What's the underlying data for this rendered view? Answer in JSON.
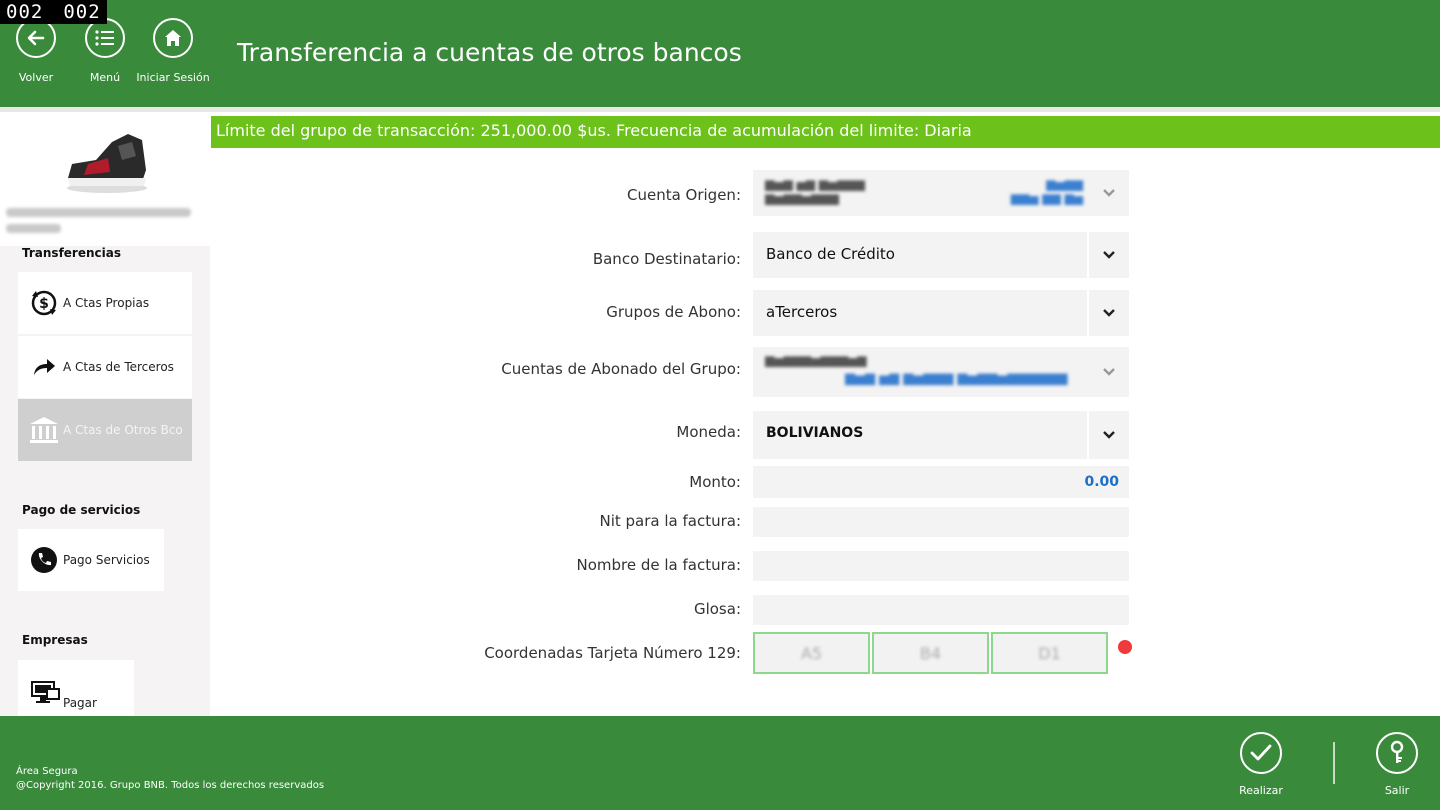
{
  "counter": [
    "002",
    "002"
  ],
  "header": {
    "title": "Transferencia a cuentas de otros bancos",
    "buttons": {
      "back": "Volver",
      "menu": "Menú",
      "login": "Iniciar Sesión"
    }
  },
  "banner": "Límite del grupo de transacción: 251,000.00 $us. Frecuencia de acumulación del limite: Diaria",
  "sidebar": {
    "sections": {
      "transfers": "Transferencias",
      "services": "Pago de servicios",
      "companies": "Empresas"
    },
    "items": {
      "own": "A Ctas Propias",
      "third": "A Ctas de Terceros",
      "other_bank": "A Ctas de Otros Bco",
      "services": "Pago Servicios",
      "pay": "Pagar"
    }
  },
  "form": {
    "labels": {
      "origin": "Cuenta Origen:",
      "bank": "Banco Destinatario:",
      "group": "Grupos de Abono:",
      "accounts": "Cuentas de Abonado del Grupo:",
      "currency": "Moneda:",
      "amount": "Monto:",
      "nit": "Nit para la factura:",
      "invoice_name": "Nombre de la factura:",
      "gloss": "Glosa:",
      "coords": "Coordenadas Tarjeta Número 129:"
    },
    "values": {
      "bank": "Banco de Crédito",
      "group": "aTerceros",
      "currency": "BOLIVIANOS",
      "amount": "0.00",
      "nit": "",
      "invoice_name": "",
      "gloss": ""
    },
    "coords": [
      "A5",
      "B4",
      "D1"
    ]
  },
  "footer": {
    "secure": "Área Segura",
    "copyright": "@Copyright 2016. Grupo BNB. Todos los derechos reservados",
    "confirm": "Realizar",
    "exit": "Salir"
  },
  "colors": {
    "header_green": "#3a8a3c",
    "banner_green": "#6cc21a",
    "amount_blue": "#1e6fc6",
    "alert_red": "#ee3a3a"
  }
}
